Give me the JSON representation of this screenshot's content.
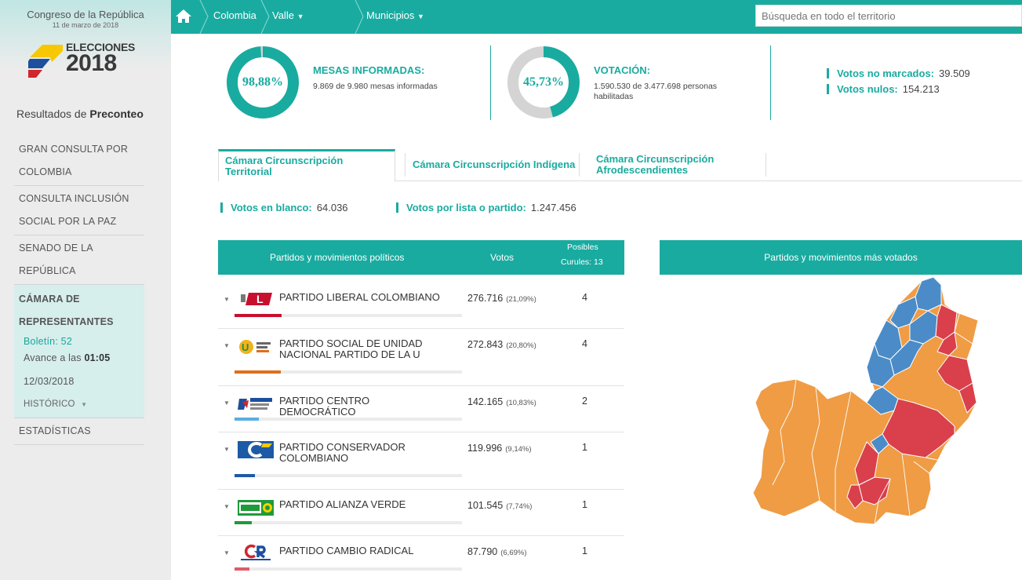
{
  "sidebar": {
    "congreso": "Congreso de la República",
    "fecha": "11 de marzo de 2018",
    "logo_title": "ELECCIONES",
    "logo_year": "2018",
    "resultados_prefix": "Resultados de",
    "resultados_bold": "Preconteo",
    "nav": [
      {
        "label": "GRAN CONSULTA POR COLOMBIA"
      },
      {
        "label": "CONSULTA INCLUSIÓN SOCIAL POR LA PAZ"
      },
      {
        "label": "SENADO DE LA REPÚBLICA"
      }
    ],
    "active": {
      "label": "CÁMARA DE REPRESENTANTES",
      "boletin": "Boletín: 52",
      "avance_prefix": "Avance a las",
      "avance_hora": "01:05",
      "fecha": "12/03/2018",
      "historico": "HISTÓRICO"
    },
    "estadisticas": "ESTADÍSTICAS"
  },
  "topbar": {
    "crumbs": [
      "Colombia",
      "Valle",
      "Municipios"
    ],
    "search_placeholder": "Búsqueda en todo el territorio",
    "home_icon": "home-icon"
  },
  "stats": {
    "mesas_pct": "98,88%",
    "mesas_fraction": 0.9888,
    "mesas_title": "MESAS INFORMADAS:",
    "mesas_text": "9.869 de 9.980 mesas informadas",
    "votacion_pct": "45,73%",
    "votacion_fraction": 0.4573,
    "votacion_title": "VOTACIÓN:",
    "votacion_text": "1.590.530 de 3.477.698 personas habilitadas",
    "no_marcados_label": "Votos no marcados:",
    "no_marcados": "39.509",
    "nulos_label": "Votos nulos:",
    "nulos": "154.213"
  },
  "tabs": [
    "Cámara Circunscripción Territorial",
    "Cámara Circunscripción Indígena",
    "Cámara Circunscripción Afrodescendientes"
  ],
  "summary": {
    "blanco_label": "Votos en blanco:",
    "blanco": "64.036",
    "lista_label": "Votos por lista o partido:",
    "lista": "1.247.456"
  },
  "table": {
    "col_partidos": "Partidos y movimientos políticos",
    "col_votos": "Votos",
    "col_curules_1": "Posibles",
    "col_curules_2": "Curules: 13",
    "rows": [
      {
        "name": "PARTIDO LIBERAL COLOMBIANO",
        "votes": "276.716",
        "pct": "(21,09%)",
        "curules": "4",
        "share": 0.2109,
        "color": "#c8102e"
      },
      {
        "name": "PARTIDO SOCIAL DE UNIDAD NACIONAL PARTIDO DE LA U",
        "votes": "272.843",
        "pct": "(20,80%)",
        "curules": "4",
        "share": 0.208,
        "color": "#e06e1a"
      },
      {
        "name": "PARTIDO CENTRO DEMOCRÁTICO",
        "votes": "142.165",
        "pct": "(10,83%)",
        "curules": "2",
        "share": 0.1083,
        "color": "#5aaee0"
      },
      {
        "name": "PARTIDO CONSERVADOR COLOMBIANO",
        "votes": "119.996",
        "pct": "(9,14%)",
        "curules": "1",
        "share": 0.0914,
        "color": "#1d5aa6"
      },
      {
        "name": "PARTIDO ALIANZA VERDE",
        "votes": "101.545",
        "pct": "(7,74%)",
        "curules": "1",
        "share": 0.0774,
        "color": "#1f9a3a"
      },
      {
        "name": "PARTIDO CAMBIO RADICAL",
        "votes": "87.790",
        "pct": "(6,69%)",
        "curules": "1",
        "share": 0.0669,
        "color": "#e05a6a"
      }
    ]
  },
  "map": {
    "title": "Partidos y movimientos más votados",
    "colors": {
      "orange": "#ef9c45",
      "blue": "#4b8cc8",
      "red": "#d9404b"
    }
  }
}
